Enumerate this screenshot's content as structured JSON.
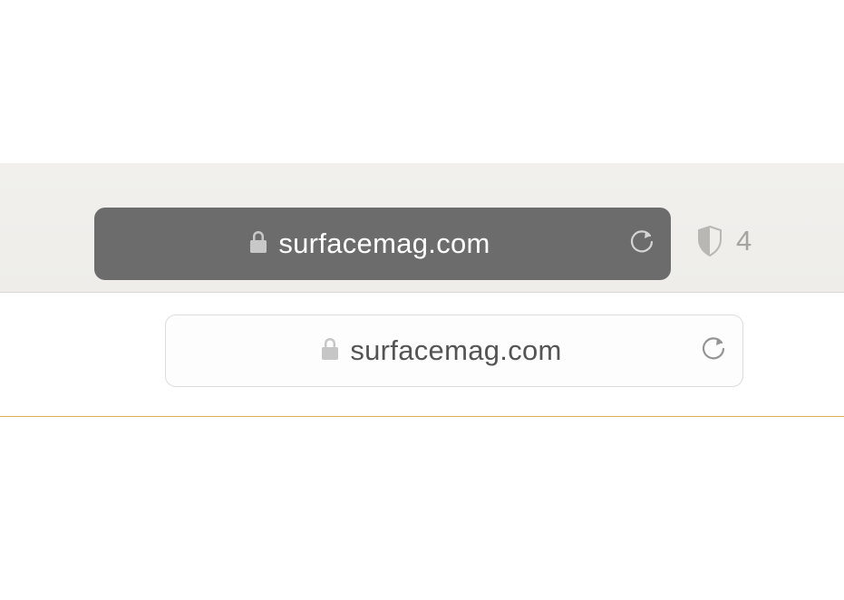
{
  "dark_bar": {
    "url": "surfacemag.com"
  },
  "light_bar": {
    "url": "surfacemag.com"
  },
  "privacy": {
    "count": "4"
  }
}
